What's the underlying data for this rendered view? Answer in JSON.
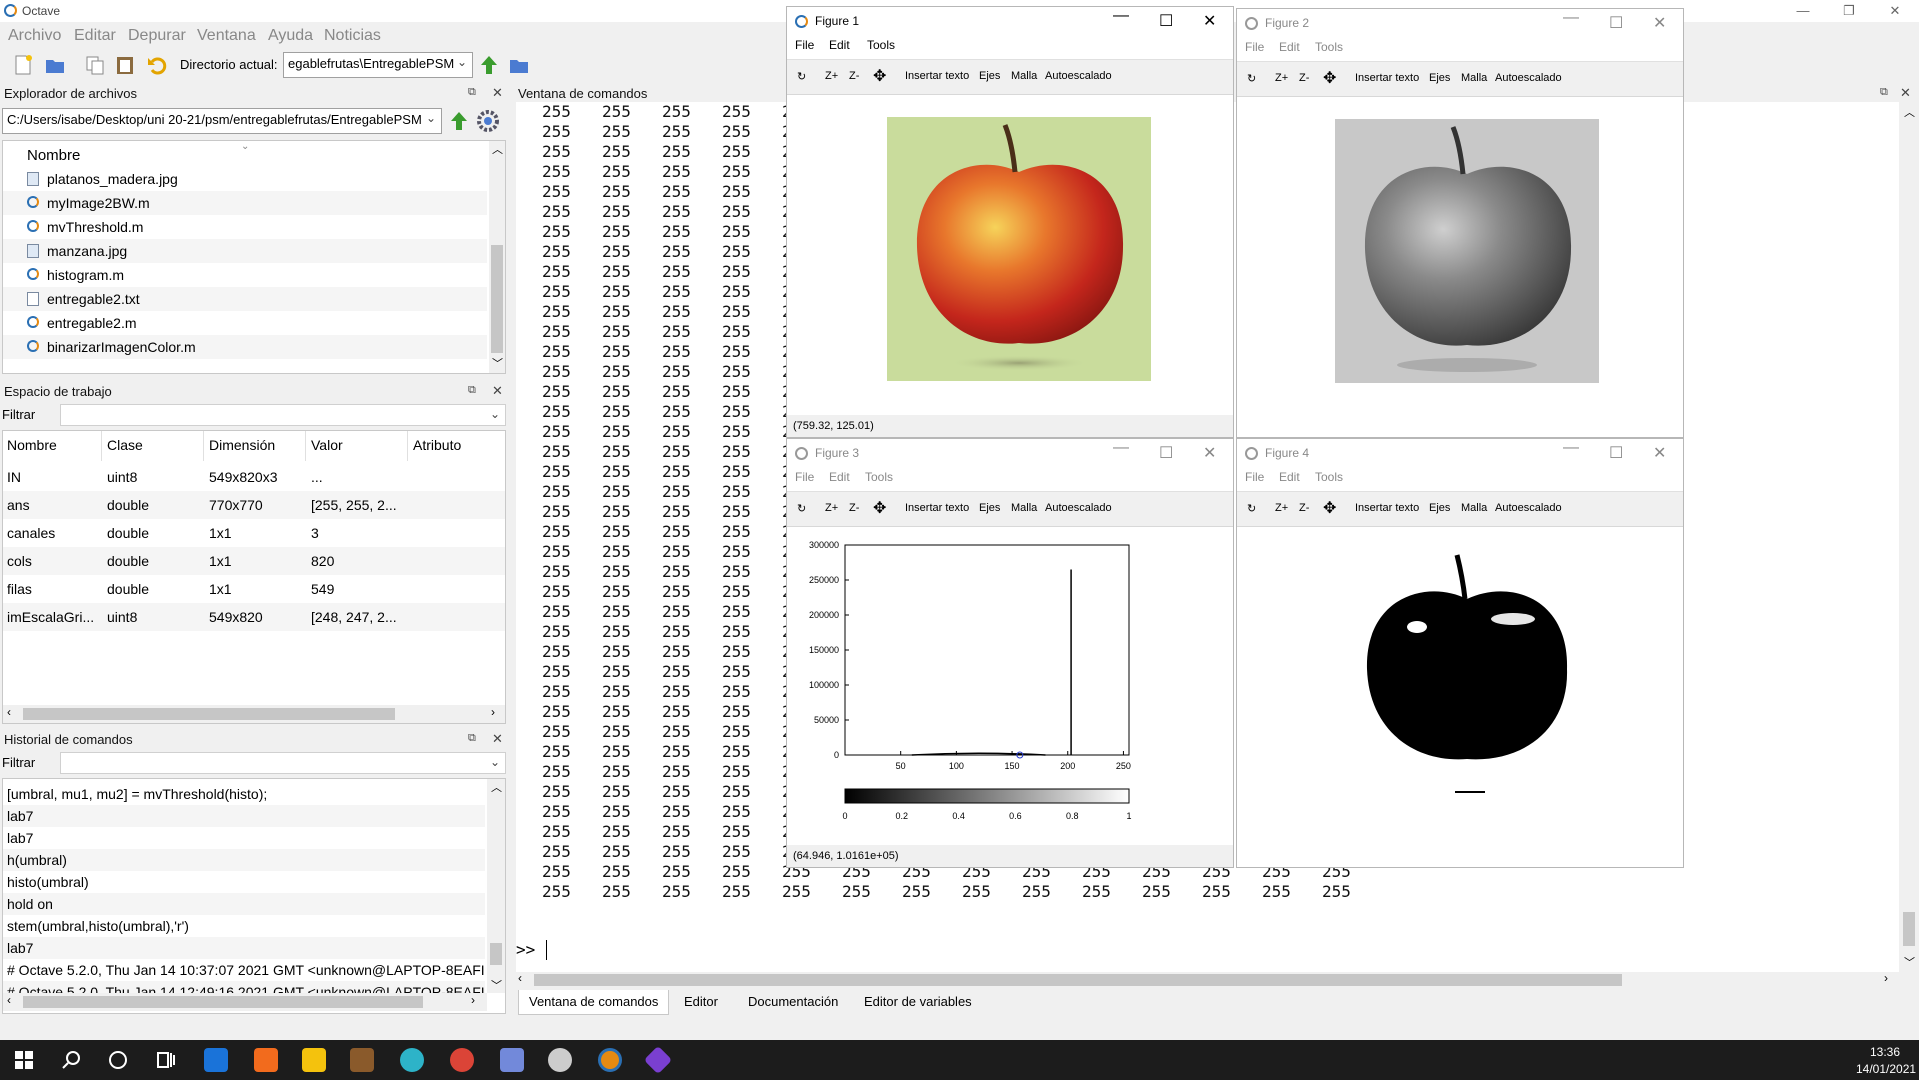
{
  "app": {
    "title": "Octave"
  },
  "menu": [
    "Archivo",
    "Editar",
    "Depurar",
    "Ventana",
    "Ayuda",
    "Noticias"
  ],
  "toolbar": {
    "dir_label": "Directorio actual:",
    "dir_value": "egablefrutas\\EntregablePSM"
  },
  "file_browser": {
    "title": "Explorador de archivos",
    "path": "C:/Users/isabe/Desktop/uni 20-21/psm/entregablefrutas/EntregablePSM",
    "column": "Nombre",
    "files": [
      {
        "name": "platanos_madera.jpg",
        "icon": "image-file-icon"
      },
      {
        "name": "myImage2BW.m",
        "icon": "octave-file-icon"
      },
      {
        "name": "mvThreshold.m",
        "icon": "octave-file-icon"
      },
      {
        "name": "manzana.jpg",
        "icon": "image-file-icon"
      },
      {
        "name": "histogram.m",
        "icon": "octave-file-icon"
      },
      {
        "name": "entregable2.txt",
        "icon": "text-file-icon"
      },
      {
        "name": "entregable2.m",
        "icon": "octave-file-icon"
      },
      {
        "name": "binarizarImagenColor.m",
        "icon": "octave-file-icon"
      }
    ]
  },
  "workspace": {
    "title": "Espacio de trabajo",
    "filter_label": "Filtrar",
    "columns": [
      "Nombre",
      "Clase",
      "Dimensión",
      "Valor",
      "Atributo"
    ],
    "rows": [
      [
        "IN",
        "uint8",
        "549x820x3",
        "..."
      ],
      [
        "ans",
        "double",
        "770x770",
        "[255, 255, 2..."
      ],
      [
        "canales",
        "double",
        "1x1",
        "3"
      ],
      [
        "cols",
        "double",
        "1x1",
        "820"
      ],
      [
        "filas",
        "double",
        "1x1",
        "549"
      ],
      [
        "imEscalaGri...",
        "uint8",
        "549x820",
        "[248, 247, 2..."
      ]
    ]
  },
  "history": {
    "title": "Historial de comandos",
    "filter_label": "Filtrar",
    "lines": [
      "[umbral, mu1, mu2] = mvThreshold(histo);",
      "lab7",
      "lab7",
      "h(umbral)",
      "histo(umbral)",
      "hold on",
      "stem(umbral,histo(umbral),'r')",
      "lab7",
      "# Octave 5.2.0, Thu Jan 14 10:37:07 2021 GMT <unknown@LAPTOP-8EAFI",
      "# Octave 5.2.0, Thu Jan 14 12:49:16 2021 GMT <unknown@LAPTOP-8EAFI"
    ]
  },
  "command_window": {
    "title": "Ventana de comandos",
    "value": "255",
    "prompt": ">>"
  },
  "tabs": [
    "Ventana de comandos",
    "Editor",
    "Documentación",
    "Editor de variables"
  ],
  "figures": [
    {
      "title": "Figure 1",
      "menu": [
        "File",
        "Edit",
        "Tools"
      ],
      "status": "(759.32, 125.01)"
    },
    {
      "title": "Figure 2",
      "menu": [
        "File",
        "Edit",
        "Tools"
      ]
    },
    {
      "title": "Figure 3",
      "menu": [
        "File",
        "Edit",
        "Tools"
      ],
      "status": "(64.946, 1.0161e+05)"
    },
    {
      "title": "Figure 4",
      "menu": [
        "File",
        "Edit",
        "Tools"
      ]
    }
  ],
  "fig_toolbar": [
    "Z+",
    "Z-",
    "Insertar texto",
    "Ejes",
    "Malla",
    "Autoescalado"
  ],
  "chart_data": {
    "type": "bar",
    "x_ticks": [
      50,
      100,
      150,
      200,
      250
    ],
    "y_ticks": [
      0,
      50000,
      100000,
      150000,
      200000,
      250000,
      300000
    ],
    "xlim": [
      0,
      255
    ],
    "ylim": [
      0,
      300000
    ],
    "peak": {
      "x": 203,
      "y": 265000
    },
    "threshold_marker": {
      "x": 157,
      "y": 0
    },
    "colorbar_ticks": [
      "0",
      "0.2",
      "0.4",
      "0.6",
      "0.8",
      "1"
    ]
  },
  "clock": {
    "time": "13:36",
    "date": "14/01/2021"
  }
}
